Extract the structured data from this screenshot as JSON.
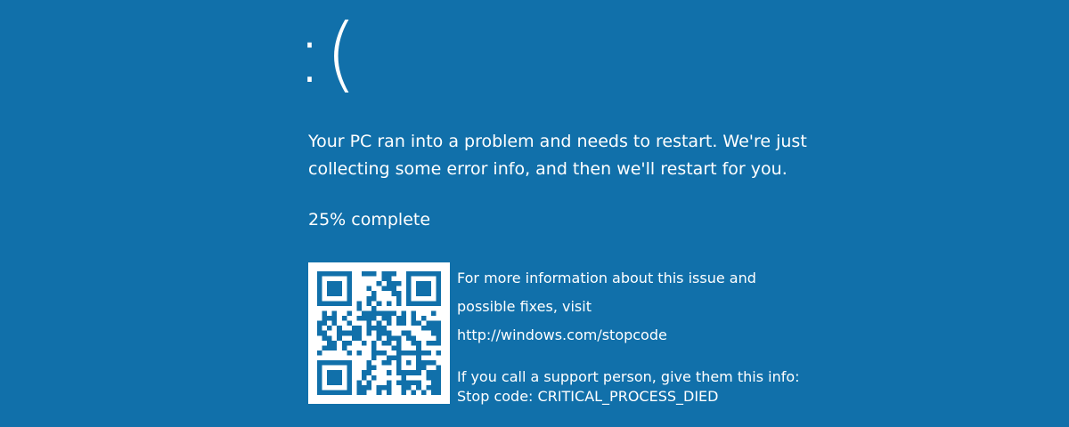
{
  "bsod": {
    "face": ":(",
    "message": "Your PC ran into a problem and needs to restart. We're just collecting some error info, and then we'll restart for you.",
    "progress_text": "25% complete",
    "progress_percent": 25,
    "info_line1": "For more information about this issue and",
    "info_line2": "possible fixes, visit",
    "url": "http://windows.com/stopcode",
    "support_text": "If you call a support person, give them this info:",
    "stop_code": "Stop code: CRITICAL_PROCESS_DIED",
    "qr_icon": "qr-code-icon",
    "colors": {
      "background": "#1170aa",
      "foreground": "#ffffff"
    }
  }
}
